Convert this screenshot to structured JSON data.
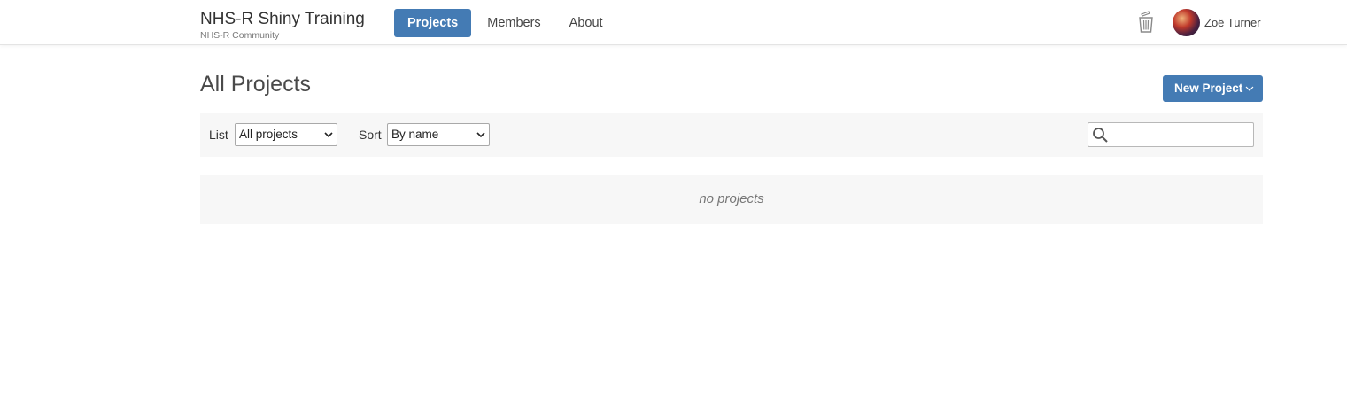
{
  "brand": {
    "title": "NHS-R Shiny Training",
    "subtitle": "NHS-R Community"
  },
  "nav": {
    "items": [
      {
        "label": "Projects",
        "active": true
      },
      {
        "label": "Members"
      },
      {
        "label": "About"
      }
    ]
  },
  "header": {
    "trash_icon": "trash-icon",
    "user_name": "Zoë Turner"
  },
  "page": {
    "title": "All Projects",
    "new_project_label": "New Project"
  },
  "filters": {
    "list_label": "List",
    "list_value": "All projects",
    "sort_label": "Sort",
    "sort_value": "By name",
    "search_placeholder": "",
    "search_value": ""
  },
  "list": {
    "empty_text": "no projects"
  },
  "colors": {
    "accent": "#447bb4",
    "panel": "#f7f7f7"
  }
}
